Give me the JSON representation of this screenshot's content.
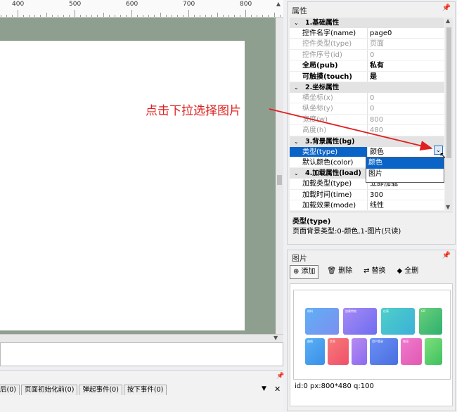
{
  "ruler": {
    "labels": [
      "400",
      "500",
      "600",
      "700",
      "800"
    ]
  },
  "properties": {
    "title": "属性",
    "categories": [
      {
        "label": "1.基础属性",
        "rows": [
          {
            "key": "控件名字(name)",
            "value": "page0",
            "style": "normal"
          },
          {
            "key": "控件类型(type)",
            "value": "页面",
            "style": "readonly"
          },
          {
            "key": "控件序号(id)",
            "value": "0",
            "style": "readonly"
          },
          {
            "key": "全局(pub)",
            "value": "私有",
            "style": "bold"
          },
          {
            "key": "可触摸(touch)",
            "value": "是",
            "style": "bold"
          }
        ]
      },
      {
        "label": "2.坐标属性",
        "rows": [
          {
            "key": "横坐标(x)",
            "value": "0",
            "style": "readonly"
          },
          {
            "key": "纵坐标(y)",
            "value": "0",
            "style": "readonly"
          },
          {
            "key": "宽度(w)",
            "value": "800",
            "style": "readonly"
          },
          {
            "key": "高度(h)",
            "value": "480",
            "style": "readonly"
          }
        ]
      },
      {
        "label": "3.背景属性(bg)",
        "rows": [
          {
            "key": "类型(type)",
            "value": "颜色",
            "style": "selected"
          },
          {
            "key": "默认颜色(color)",
            "value": "",
            "style": "normal"
          }
        ]
      },
      {
        "label": "4.加载属性(load)",
        "rows": [
          {
            "key": "加载类型(type)",
            "value": "立即加载",
            "style": "normal"
          },
          {
            "key": "加载时间(time)",
            "value": "300",
            "style": "normal"
          },
          {
            "key": "加载效果(mode)",
            "value": "线性",
            "style": "normal"
          }
        ]
      }
    ],
    "dropdown_options": [
      "颜色",
      "图片"
    ],
    "dropdown_selected": "颜色",
    "description": {
      "title": "类型(type)",
      "text": "页面背景类型:0-颜色,1-图片(只读)"
    }
  },
  "images": {
    "title": "图片",
    "toolbar": {
      "add": "添加",
      "delete": "删除",
      "replace": "替换",
      "delete_all": "全删"
    },
    "tiles": [
      "材料",
      "加载特效",
      "仪表",
      "GIF",
      "曲线",
      "文本",
      "用户登录",
      "按钮"
    ],
    "info": "id:0 px:800*480 q:100"
  },
  "events": {
    "tabs": [
      "页面初始化前(0)",
      "弹起事件(0)",
      "按下事件(0)"
    ],
    "first_tab_fragment": "后(0)"
  },
  "annotation": {
    "text": "点击下拉选择图片"
  },
  "icons": {
    "pin": "pin-icon",
    "close": "close-icon",
    "dropdown": "chevron-down-icon"
  },
  "colors": {
    "canvas_bg": "#8f9f8f",
    "selection": "#0a64c8",
    "annotation": "#e02020"
  }
}
